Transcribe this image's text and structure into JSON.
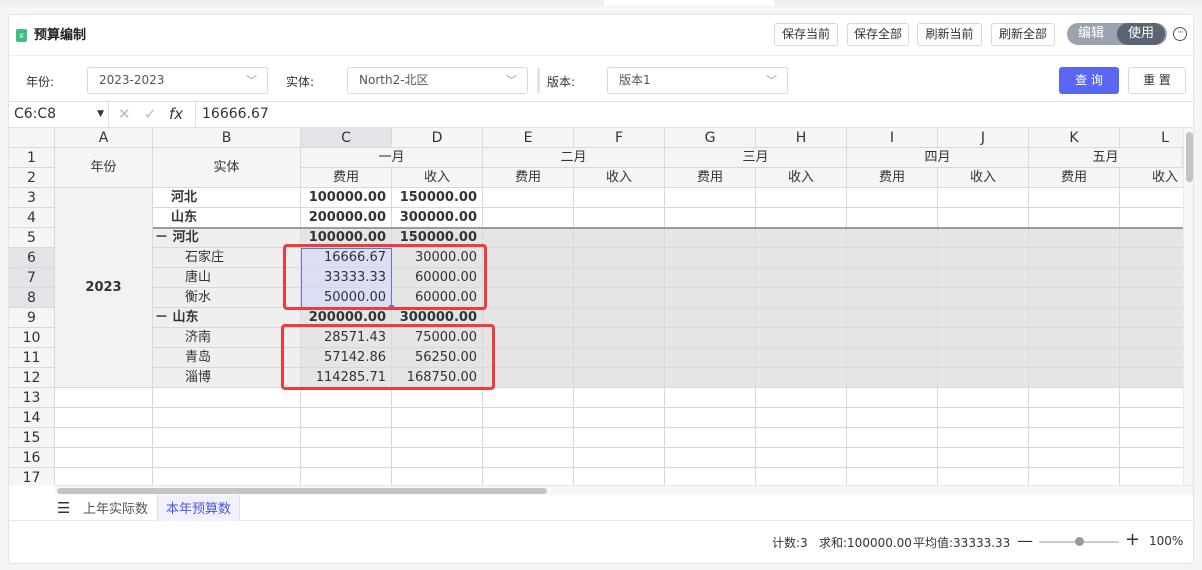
{
  "header": {
    "title": "预算编制",
    "buttons": [
      "保存当前",
      "保存全部",
      "刷新当前",
      "刷新全部"
    ],
    "toggle": {
      "edit": "编辑",
      "use": "使用"
    }
  },
  "filters": {
    "year_label": "年份:",
    "year_value": "2023-2023",
    "entity_label": "实体:",
    "entity_value": "North2-北区",
    "version_label": "版本:",
    "version_value": "版本1",
    "query_label": "查 询",
    "reset_label": "重 置"
  },
  "formula_bar": {
    "name_box": "C6:C8",
    "fx": "fx",
    "value": "16666.67"
  },
  "sheet": {
    "columns": [
      "A",
      "B",
      "C",
      "D",
      "E",
      "F",
      "G",
      "H",
      "I",
      "J",
      "K",
      "L"
    ],
    "rows": [
      "1",
      "2",
      "3",
      "4",
      "5",
      "6",
      "7",
      "8",
      "9",
      "10",
      "11",
      "12",
      "13",
      "14",
      "15",
      "16",
      "17"
    ],
    "header_year": "年份",
    "header_entity": "实体",
    "months": [
      "一月",
      "二月",
      "三月",
      "四月",
      "五月"
    ],
    "sub_headers": [
      "费用",
      "收入"
    ],
    "year_value": "2023",
    "data_rows": [
      {
        "label": "河北",
        "expense": "100000.00",
        "income": "150000.00"
      },
      {
        "label": "山东",
        "expense": "200000.00",
        "income": "300000.00"
      },
      {
        "label": "－ 河北",
        "expense": "100000.00",
        "income": "150000.00"
      },
      {
        "label": "石家庄",
        "expense": "16666.67",
        "income": "30000.00"
      },
      {
        "label": "唐山",
        "expense": "33333.33",
        "income": "60000.00"
      },
      {
        "label": "衡水",
        "expense": "50000.00",
        "income": "60000.00"
      },
      {
        "label": "－ 山东",
        "expense": "200000.00",
        "income": "300000.00"
      },
      {
        "label": "济南",
        "expense": "28571.43",
        "income": "75000.00"
      },
      {
        "label": "青岛",
        "expense": "57142.86",
        "income": "56250.00"
      },
      {
        "label": "淄博",
        "expense": "114285.71",
        "income": "168750.00"
      }
    ]
  },
  "sheet_tabs": [
    "上年实际数",
    "本年预算数"
  ],
  "status": {
    "count": "计数:3",
    "sum": "求和:100000.00",
    "avg": "平均值:33333.33",
    "zoom": "100%"
  },
  "colors": {
    "accent": "#5a67f2",
    "highlight_border": "#ee3b3b",
    "selection": "#dcdff3"
  }
}
